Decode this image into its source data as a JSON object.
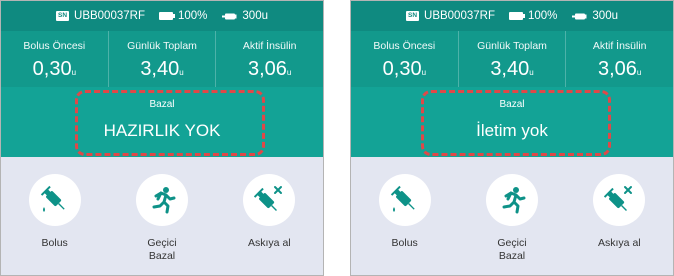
{
  "colors": {
    "header_teal": "#0f8a80",
    "stats_teal": "#12998c",
    "basal_teal": "#13a396",
    "icon_teal": "#0e9288",
    "panel_bg": "#e3e6f1",
    "highlight_red": "#e04848"
  },
  "screens": [
    {
      "status": {
        "sn_badge": "SN",
        "serial": "UBB00037RF",
        "battery": "100%",
        "insulin": "300u"
      },
      "stats": [
        {
          "label": "Bolus Öncesi",
          "value": "0,30",
          "unit": "u"
        },
        {
          "label": "Günlük Toplam",
          "value": "3,40",
          "unit": "u"
        },
        {
          "label": "Aktif İnsülin",
          "value": "3,06",
          "unit": "u"
        }
      ],
      "basal": {
        "label": "Bazal",
        "value": "HAZIRLIK YOK"
      },
      "actions": [
        {
          "label": "Bolus",
          "icon": "syringe-icon"
        },
        {
          "label": "Geçici\nBazal",
          "icon": "running-person-icon"
        },
        {
          "label": "Askıya al",
          "icon": "syringe-cross-icon"
        }
      ]
    },
    {
      "status": {
        "sn_badge": "SN",
        "serial": "UBB00037RF",
        "battery": "100%",
        "insulin": "300u"
      },
      "stats": [
        {
          "label": "Bolus Öncesi",
          "value": "0,30",
          "unit": "u"
        },
        {
          "label": "Günlük Toplam",
          "value": "3,40",
          "unit": "u"
        },
        {
          "label": "Aktif İnsülin",
          "value": "3,06",
          "unit": "u"
        }
      ],
      "basal": {
        "label": "Bazal",
        "value": "İletim yok"
      },
      "actions": [
        {
          "label": "Bolus",
          "icon": "syringe-icon"
        },
        {
          "label": "Geçici\nBazal",
          "icon": "running-person-icon"
        },
        {
          "label": "Askıya al",
          "icon": "syringe-cross-icon"
        }
      ]
    }
  ]
}
